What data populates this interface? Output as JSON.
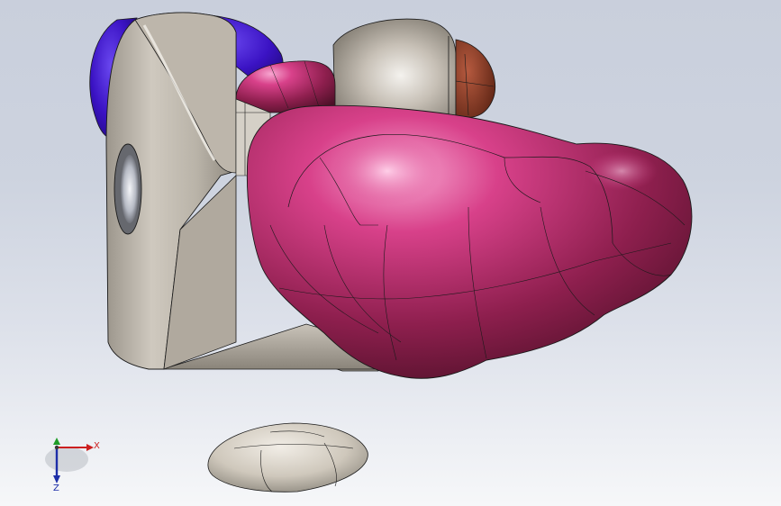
{
  "viewport": {
    "background_top": "#c9cfdc",
    "background_bottom": "#f6f7f9"
  },
  "model": {
    "colors": {
      "metal": "#c4bdb1",
      "metal_dark": "#8b857b",
      "magenta": "#c72c76",
      "magenta_dark": "#5b1530",
      "blue": "#3b13c4",
      "brown": "#8a3a26",
      "edge": "#1a1a1a"
    },
    "icons": [
      "triad-icon"
    ]
  },
  "triad": {
    "x_label": "X",
    "z_label": "Z",
    "x_color": "#cc1f1f",
    "y_color": "#1f9c27",
    "z_color": "#1d2ea8"
  }
}
